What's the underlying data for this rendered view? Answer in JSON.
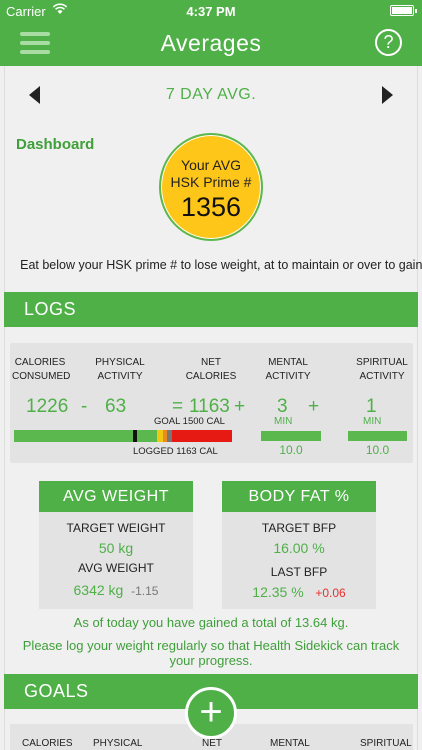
{
  "status": {
    "carrier": "Carrier",
    "time": "4:37 PM"
  },
  "nav": {
    "title": "Averages",
    "help": "?"
  },
  "period": {
    "label": "7 DAY AVG."
  },
  "dashboard": {
    "label": "Dashboard",
    "prime_line1": "Your AVG",
    "prime_line2": "HSK Prime #",
    "prime_value": "1356",
    "hint": "Eat below your HSK prime # to lose weight, at to maintain or over to gain."
  },
  "logs": {
    "title": "LOGS",
    "headers": [
      "CALORIES\nCONSUMED",
      "PHYSICAL\nACTIVITY",
      "NET\nCALORIES",
      "MENTAL\nACTIVITY",
      "SPIRITUAL\nACTIVITY"
    ],
    "consumed": "1226",
    "minus": "-",
    "physical": "63",
    "equals": "=",
    "net": "1163",
    "plus1": "+",
    "mental": "3",
    "plus2": "+",
    "spiritual": "1",
    "min_label": "MIN",
    "goal_text": "GOAL 1500 CAL",
    "logged_text": "LOGGED 1163 CAL",
    "mental_avg": "10.0",
    "spiritual_avg": "10.0",
    "colors": {
      "green": "#5ab84f",
      "yellow": "#f2c811",
      "orange": "#e98b1e",
      "red": "#e61a12"
    }
  },
  "weight": {
    "title": "AVG WEIGHT",
    "target_label": "TARGET WEIGHT",
    "target_value": "50 kg",
    "avg_label": "AVG WEIGHT",
    "avg_value": "6342 kg",
    "avg_change": "-1.15"
  },
  "bodyfat": {
    "title": "BODY FAT %",
    "target_label": "TARGET BFP",
    "target_value": "16.00 %",
    "last_label": "LAST BFP",
    "last_value": "12.35 %",
    "last_change": "+0.06"
  },
  "messages": {
    "gain": "As of today you have gained a total of 13.64 kg.",
    "advice": "Please log your weight regularly so that Health Sidekick can track your progress."
  },
  "goals": {
    "title": "GOALS",
    "headers": [
      "CALORIES",
      "PHYSICAL",
      "NET",
      "MENTAL",
      "SPIRITUAL"
    ]
  },
  "fab": {
    "symbol": "+"
  }
}
